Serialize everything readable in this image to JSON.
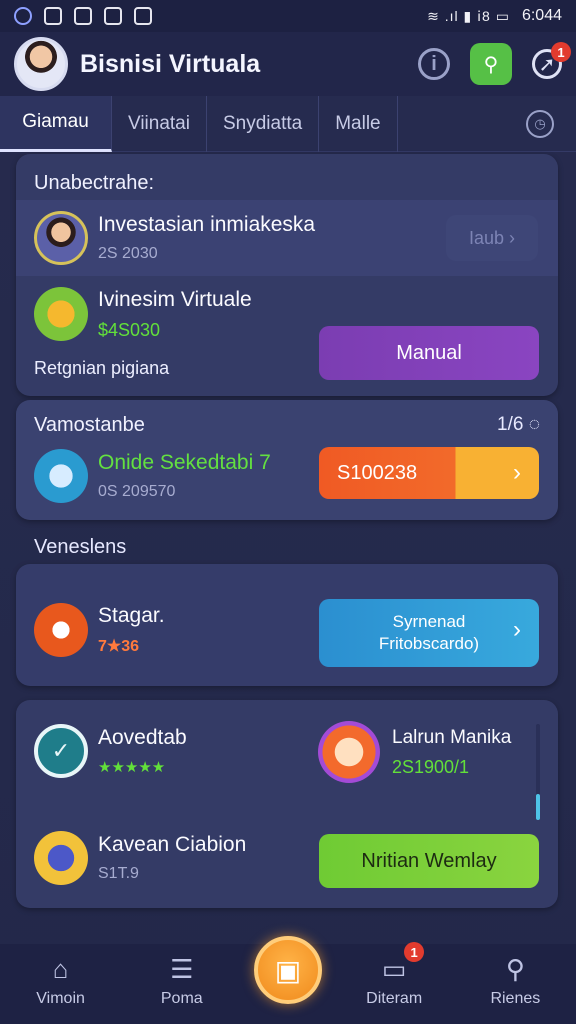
{
  "status_bar": {
    "time": "6:044",
    "system": "≋ .ıl ▮ ⅰ8 ▭"
  },
  "header": {
    "title": "Bisnisi Virtuala",
    "notification_count": "1"
  },
  "tabs": [
    {
      "label": "Giamau",
      "active": true
    },
    {
      "label": "Viinatai"
    },
    {
      "label": "Snydiatta"
    },
    {
      "label": "Malle"
    }
  ],
  "card1": {
    "title": "Unabectrahe:",
    "item1": {
      "title": "Investasian inmiakeska",
      "sub": "2S 2030",
      "button": "Iaub"
    },
    "item2": {
      "title": "Ivinesim Virtuale",
      "sub": "$4S030"
    },
    "footer_text": "Retgnian pigiana",
    "button": "Manual"
  },
  "card2": {
    "title": "Vamostanbe",
    "counter": "1/6",
    "item": {
      "title": "Onide Sekedtabi 7",
      "sub": "0S 209570"
    },
    "button": "S100238"
  },
  "section_label": "Veneslens",
  "card3": {
    "item": {
      "title": "Stagar.",
      "sub": "7★36"
    },
    "button_line1": "Syrnenad",
    "button_line2": "Fritobscardo)"
  },
  "card4": {
    "item1": {
      "title": "Aovedtab",
      "stars": "★★★★★"
    },
    "item2": {
      "title": "Lalrun Manika",
      "sub": "2S1900/1"
    },
    "item3": {
      "title": "Kavean Ciabion",
      "sub": "S1T.9"
    },
    "button": "Nritian Wemlay"
  },
  "bottom_nav": [
    {
      "label": "Vimoin",
      "icon": "home-icon"
    },
    {
      "label": "Poma",
      "icon": "list-icon"
    },
    {
      "label": "Diteram",
      "icon": "calendar-icon",
      "badge": "1"
    },
    {
      "label": "Rienes",
      "icon": "search-icon"
    }
  ],
  "colors": {
    "accent_purple": "#7a3fb0",
    "accent_orange": "#f26a2a",
    "accent_blue": "#2ea0d6",
    "accent_green": "#7ed43a"
  }
}
